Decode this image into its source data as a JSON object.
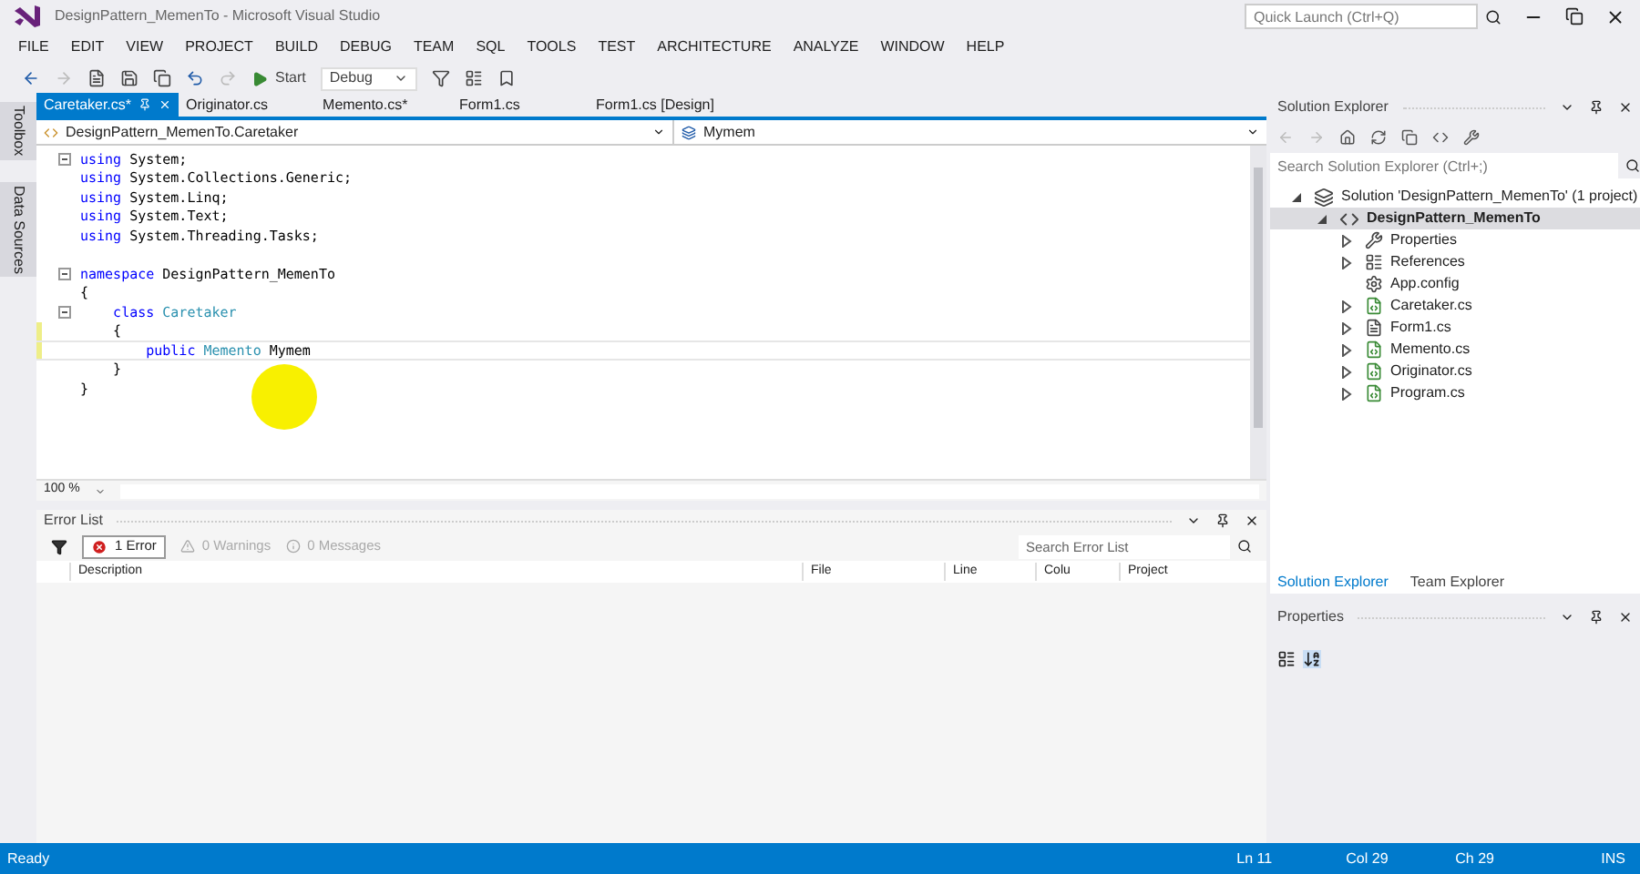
{
  "window": {
    "title": "DesignPattern_MemenTo - Microsoft Visual Studio",
    "quick_launch": {
      "placeholder": "Quick Launch (Ctrl+Q)"
    }
  },
  "menu": [
    "FILE",
    "EDIT",
    "VIEW",
    "PROJECT",
    "BUILD",
    "DEBUG",
    "TEAM",
    "SQL",
    "TOOLS",
    "TEST",
    "ARCHITECTURE",
    "ANALYZE",
    "WINDOW",
    "HELP"
  ],
  "toolbar": {
    "start": "Start",
    "configuration": "Debug"
  },
  "side_tabs": [
    "Toolbox",
    "Data Sources"
  ],
  "doc_tabs": [
    {
      "label": "Caretaker.cs*",
      "selected": true
    },
    {
      "label": "Originator.cs",
      "selected": false
    },
    {
      "label": "Memento.cs*",
      "selected": false
    },
    {
      "label": "Form1.cs",
      "selected": false
    },
    {
      "label": "Form1.cs [Design]",
      "selected": false
    }
  ],
  "nav_bar": {
    "type": "DesignPattern_MemenTo.Caretaker",
    "member": "Mymem"
  },
  "code": [
    {
      "fold": true,
      "changed": false,
      "tokens": [
        {
          "kind": "keyword",
          "text": "using"
        },
        {
          "kind": "plain",
          "text": " System;"
        }
      ]
    },
    {
      "fold": false,
      "changed": false,
      "tokens": [
        {
          "kind": "keyword",
          "text": "using"
        },
        {
          "kind": "plain",
          "text": " System.Collections.Generic;"
        }
      ]
    },
    {
      "fold": false,
      "changed": false,
      "tokens": [
        {
          "kind": "keyword",
          "text": "using"
        },
        {
          "kind": "plain",
          "text": " System.Linq;"
        }
      ]
    },
    {
      "fold": false,
      "changed": false,
      "tokens": [
        {
          "kind": "keyword",
          "text": "using"
        },
        {
          "kind": "plain",
          "text": " System.Text;"
        }
      ]
    },
    {
      "fold": false,
      "changed": false,
      "tokens": [
        {
          "kind": "keyword",
          "text": "using"
        },
        {
          "kind": "plain",
          "text": " System.Threading.Tasks;"
        }
      ]
    },
    {
      "fold": false,
      "changed": false
    },
    {
      "fold": true,
      "changed": false,
      "tokens": [
        {
          "kind": "keyword",
          "text": "namespace"
        },
        {
          "kind": "plain",
          "text": " DesignPattern_MemenTo"
        }
      ]
    },
    {
      "fold": false,
      "changed": false,
      "tokens": [
        {
          "kind": "plain",
          "text": "{"
        }
      ]
    },
    {
      "fold": true,
      "changed": false,
      "tokens": [
        {
          "kind": "keyword",
          "text": "    class"
        },
        {
          "kind": "type",
          "text": " Caretaker"
        }
      ]
    },
    {
      "fold": false,
      "changed": true,
      "tokens": [
        {
          "kind": "plain",
          "text": "    {"
        }
      ]
    },
    {
      "fold": false,
      "changed": true,
      "current": true,
      "tokens": [
        {
          "kind": "keyword",
          "text": "        public"
        },
        {
          "kind": "type",
          "text": " Memento"
        },
        {
          "kind": "plain",
          "text": " Mymem"
        }
      ]
    },
    {
      "fold": false,
      "changed": false,
      "tokens": [
        {
          "kind": "plain",
          "text": "    }"
        }
      ]
    },
    {
      "fold": false,
      "changed": false,
      "tokens": [
        {
          "kind": "plain",
          "text": "}"
        }
      ]
    }
  ],
  "zoom": "100 %",
  "error_list": {
    "title": "Error List",
    "errors": "1 Error",
    "warnings": "0 Warnings",
    "messages": "0 Messages",
    "search": {
      "placeholder": "Search Error List"
    },
    "columns": [
      "Description",
      "File",
      "Line",
      "Colu",
      "Project"
    ]
  },
  "solution_explorer": {
    "title": "Solution Explorer",
    "search": {
      "placeholder": "Search Solution Explorer (Ctrl+;)"
    },
    "tree": [
      {
        "label": "Solution 'DesignPattern_MemenTo' (1 project)",
        "kind": "solution",
        "expanded": true,
        "selected": false,
        "children": [
          {
            "label": "DesignPattern_MemenTo",
            "kind": "project",
            "expanded": true,
            "selected": true,
            "children": [
              {
                "label": "Properties",
                "kind": "properties",
                "expanded": false,
                "selected": false
              },
              {
                "label": "References",
                "kind": "references",
                "expanded": false,
                "selected": false
              },
              {
                "label": "App.config",
                "kind": "config",
                "selected": false
              },
              {
                "label": "Caretaker.cs",
                "kind": "csharp",
                "expanded": false,
                "selected": false
              },
              {
                "label": "Form1.cs",
                "kind": "form",
                "expanded": false,
                "selected": false
              },
              {
                "label": "Memento.cs",
                "kind": "csharp",
                "expanded": false,
                "selected": false
              },
              {
                "label": "Originator.cs",
                "kind": "csharp",
                "expanded": false,
                "selected": false
              },
              {
                "label": "Program.cs",
                "kind": "csharp",
                "expanded": false,
                "selected": false
              }
            ]
          }
        ]
      }
    ],
    "tabs": [
      {
        "label": "Solution Explorer",
        "selected": true
      },
      {
        "label": "Team Explorer",
        "selected": false
      }
    ]
  },
  "properties": {
    "title": "Properties"
  },
  "status_bar": {
    "state": "Ready",
    "line": "Ln 11",
    "column": "Col 29",
    "char": "Ch 29",
    "mode": "INS"
  }
}
